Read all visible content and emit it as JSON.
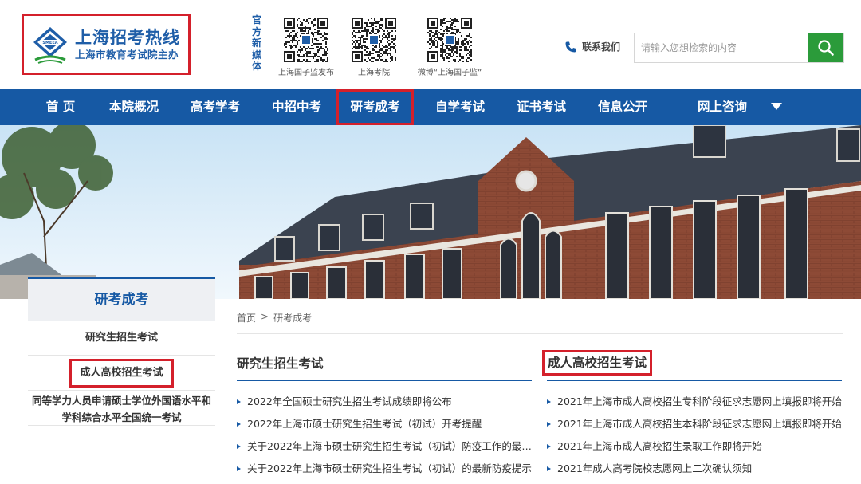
{
  "header": {
    "logo_title": "上海招考热线",
    "logo_subtitle": "上海市教育考试院主办",
    "media_label": "官方新媒体",
    "qr_codes": [
      {
        "caption": "上海国子监发布"
      },
      {
        "caption": "上海考院"
      },
      {
        "caption": "微博“上海国子监”"
      }
    ],
    "contact_label": "联系我们",
    "search_placeholder": "请输入您想检索的内容"
  },
  "nav": {
    "items": [
      {
        "label": "首 页"
      },
      {
        "label": "本院概况"
      },
      {
        "label": "高考学考"
      },
      {
        "label": "中招中考"
      },
      {
        "label": "研考成考"
      },
      {
        "label": "自学考试"
      },
      {
        "label": "证书考试"
      },
      {
        "label": "信息公开"
      },
      {
        "label": "网上咨询"
      }
    ],
    "active_index": 4
  },
  "sidebar": {
    "title": "研考成考",
    "items": [
      {
        "label": "研究生招生考试"
      },
      {
        "label": "成人高校招生考试"
      },
      {
        "label": "同等学力人员申请硕士学位外国语水平和学科综合水平全国统一考试"
      }
    ]
  },
  "breadcrumb": {
    "home": "首页",
    "separator": ">",
    "current": "研考成考"
  },
  "columns": {
    "left": {
      "title": "研究生招生考试",
      "items": [
        "2022年全国硕士研究生招生考试成绩即将公布",
        "2022年上海市硕士研究生招生考试（初试）开考提醒",
        "关于2022年上海市硕士研究生招生考试（初试）防疫工作的最新...",
        "关于2022年上海市硕士研究生招生考试（初试）的最新防疫提示"
      ]
    },
    "right": {
      "title": "成人高校招生考试",
      "items": [
        "2021年上海市成人高校招生专科阶段征求志愿网上填报即将开始",
        "2021年上海市成人高校招生本科阶段征求志愿网上填报即将开始",
        "2021年上海市成人高校招生录取工作即将开始",
        "2021年成人高考院校志愿网上二次确认须知"
      ]
    }
  },
  "colors": {
    "brand_blue": "#1659a4",
    "highlight_red": "#d4202b",
    "search_green": "#2b9b3a"
  },
  "icons": {
    "logo": "smeea-emblem-icon",
    "phone": "phone-icon",
    "search": "search-icon",
    "nav_more": "chevron-down-icon",
    "qr": "qr-code-icon",
    "list_bullet": "triangle-bullet-icon"
  }
}
